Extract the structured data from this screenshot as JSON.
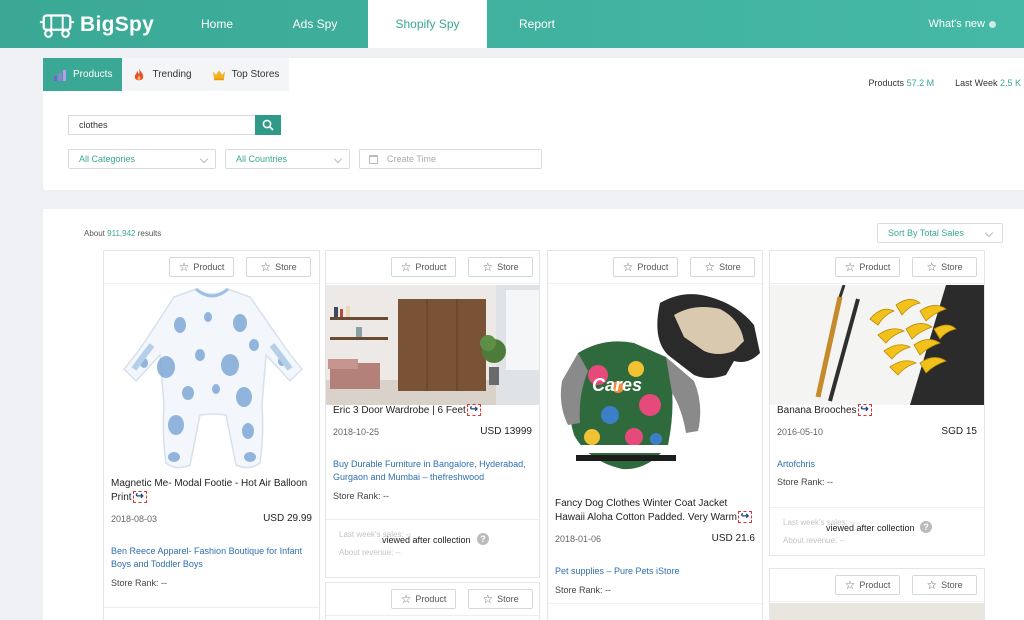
{
  "nav": {
    "logo": "BigSpy",
    "items": [
      {
        "label": "Home"
      },
      {
        "label": "Ads Spy"
      },
      {
        "label": "Shopify Spy"
      },
      {
        "label": "Report"
      }
    ],
    "active_index": 2,
    "whats_new": "What's new"
  },
  "subtabs": [
    {
      "label": "Products",
      "icon": "bar-chart-icon"
    },
    {
      "label": "Trending",
      "icon": "flame-icon"
    },
    {
      "label": "Top Stores",
      "icon": "crown-icon"
    }
  ],
  "stats": {
    "products_label": "Products",
    "products_value": "57.2 M",
    "last_week_label": "Last Week",
    "last_week_value": "2.5 K"
  },
  "filters": {
    "search_value": "clothes",
    "category": "All Categories",
    "country": "All Countries",
    "date_placeholder": "Create Time"
  },
  "results": {
    "prefix": "About",
    "count": "911,942",
    "suffix": "results",
    "sort": "Sort By Total Sales"
  },
  "card_buttons": {
    "product": "Product",
    "store": "Store"
  },
  "extra_info": {
    "last_week_sales": "Last week's sales: --",
    "about_revenue": "About revenue: --",
    "overlay": "viewed after collection",
    "help": "?"
  },
  "products": [
    {
      "title": "Magnetic Me- Modal Footie - Hot Air Balloon Print",
      "date": "2018-08-03",
      "price": "USD 29.99",
      "store": "Ben Reece Apparel- Fashion Boutique for Infant Boys and Toddler Boys",
      "rank": "Store Rank: --"
    },
    {
      "title": "Eric 3 Door Wardrobe | 6 Feet",
      "date": "2018-10-25",
      "price": "USD 13999",
      "store": "Buy Durable Furniture in Bangalore, Hyderabad, Gurgaon and Mumbai – thefreshwood",
      "rank": "Store Rank: --"
    },
    {
      "title": "Fancy Dog Clothes Winter Coat Jacket Hawaii Aloha Cotton Padded. Very Warm",
      "date": "2018-01-06",
      "price": "USD 21.6",
      "store": "Pet supplies – Pure Pets iStore",
      "rank": "Store Rank: --",
      "tshirt_text": "Cares"
    },
    {
      "title": "Banana Brooches",
      "date": "2016-05-10",
      "price": "SGD 15",
      "store": "Artofchris",
      "rank": "Store Rank: --"
    }
  ],
  "colors": {
    "accent": "#3aa894",
    "link": "#2f6fb0"
  }
}
